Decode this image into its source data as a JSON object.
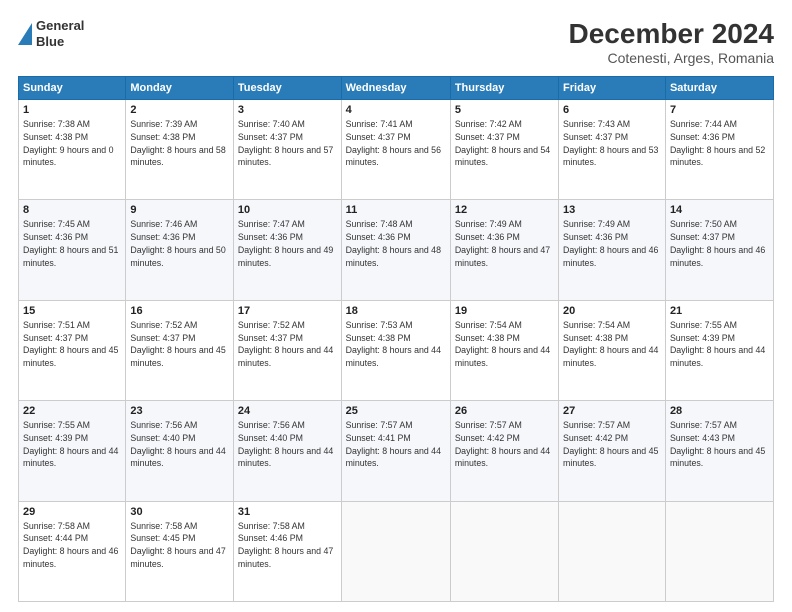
{
  "header": {
    "logo_line1": "General",
    "logo_line2": "Blue",
    "title": "December 2024",
    "subtitle": "Cotenesti, Arges, Romania"
  },
  "weekdays": [
    "Sunday",
    "Monday",
    "Tuesday",
    "Wednesday",
    "Thursday",
    "Friday",
    "Saturday"
  ],
  "weeks": [
    [
      {
        "day": "1",
        "sunrise": "Sunrise: 7:38 AM",
        "sunset": "Sunset: 4:38 PM",
        "daylight": "Daylight: 9 hours and 0 minutes."
      },
      {
        "day": "2",
        "sunrise": "Sunrise: 7:39 AM",
        "sunset": "Sunset: 4:38 PM",
        "daylight": "Daylight: 8 hours and 58 minutes."
      },
      {
        "day": "3",
        "sunrise": "Sunrise: 7:40 AM",
        "sunset": "Sunset: 4:37 PM",
        "daylight": "Daylight: 8 hours and 57 minutes."
      },
      {
        "day": "4",
        "sunrise": "Sunrise: 7:41 AM",
        "sunset": "Sunset: 4:37 PM",
        "daylight": "Daylight: 8 hours and 56 minutes."
      },
      {
        "day": "5",
        "sunrise": "Sunrise: 7:42 AM",
        "sunset": "Sunset: 4:37 PM",
        "daylight": "Daylight: 8 hours and 54 minutes."
      },
      {
        "day": "6",
        "sunrise": "Sunrise: 7:43 AM",
        "sunset": "Sunset: 4:37 PM",
        "daylight": "Daylight: 8 hours and 53 minutes."
      },
      {
        "day": "7",
        "sunrise": "Sunrise: 7:44 AM",
        "sunset": "Sunset: 4:36 PM",
        "daylight": "Daylight: 8 hours and 52 minutes."
      }
    ],
    [
      {
        "day": "8",
        "sunrise": "Sunrise: 7:45 AM",
        "sunset": "Sunset: 4:36 PM",
        "daylight": "Daylight: 8 hours and 51 minutes."
      },
      {
        "day": "9",
        "sunrise": "Sunrise: 7:46 AM",
        "sunset": "Sunset: 4:36 PM",
        "daylight": "Daylight: 8 hours and 50 minutes."
      },
      {
        "day": "10",
        "sunrise": "Sunrise: 7:47 AM",
        "sunset": "Sunset: 4:36 PM",
        "daylight": "Daylight: 8 hours and 49 minutes."
      },
      {
        "day": "11",
        "sunrise": "Sunrise: 7:48 AM",
        "sunset": "Sunset: 4:36 PM",
        "daylight": "Daylight: 8 hours and 48 minutes."
      },
      {
        "day": "12",
        "sunrise": "Sunrise: 7:49 AM",
        "sunset": "Sunset: 4:36 PM",
        "daylight": "Daylight: 8 hours and 47 minutes."
      },
      {
        "day": "13",
        "sunrise": "Sunrise: 7:49 AM",
        "sunset": "Sunset: 4:36 PM",
        "daylight": "Daylight: 8 hours and 46 minutes."
      },
      {
        "day": "14",
        "sunrise": "Sunrise: 7:50 AM",
        "sunset": "Sunset: 4:37 PM",
        "daylight": "Daylight: 8 hours and 46 minutes."
      }
    ],
    [
      {
        "day": "15",
        "sunrise": "Sunrise: 7:51 AM",
        "sunset": "Sunset: 4:37 PM",
        "daylight": "Daylight: 8 hours and 45 minutes."
      },
      {
        "day": "16",
        "sunrise": "Sunrise: 7:52 AM",
        "sunset": "Sunset: 4:37 PM",
        "daylight": "Daylight: 8 hours and 45 minutes."
      },
      {
        "day": "17",
        "sunrise": "Sunrise: 7:52 AM",
        "sunset": "Sunset: 4:37 PM",
        "daylight": "Daylight: 8 hours and 44 minutes."
      },
      {
        "day": "18",
        "sunrise": "Sunrise: 7:53 AM",
        "sunset": "Sunset: 4:38 PM",
        "daylight": "Daylight: 8 hours and 44 minutes."
      },
      {
        "day": "19",
        "sunrise": "Sunrise: 7:54 AM",
        "sunset": "Sunset: 4:38 PM",
        "daylight": "Daylight: 8 hours and 44 minutes."
      },
      {
        "day": "20",
        "sunrise": "Sunrise: 7:54 AM",
        "sunset": "Sunset: 4:38 PM",
        "daylight": "Daylight: 8 hours and 44 minutes."
      },
      {
        "day": "21",
        "sunrise": "Sunrise: 7:55 AM",
        "sunset": "Sunset: 4:39 PM",
        "daylight": "Daylight: 8 hours and 44 minutes."
      }
    ],
    [
      {
        "day": "22",
        "sunrise": "Sunrise: 7:55 AM",
        "sunset": "Sunset: 4:39 PM",
        "daylight": "Daylight: 8 hours and 44 minutes."
      },
      {
        "day": "23",
        "sunrise": "Sunrise: 7:56 AM",
        "sunset": "Sunset: 4:40 PM",
        "daylight": "Daylight: 8 hours and 44 minutes."
      },
      {
        "day": "24",
        "sunrise": "Sunrise: 7:56 AM",
        "sunset": "Sunset: 4:40 PM",
        "daylight": "Daylight: 8 hours and 44 minutes."
      },
      {
        "day": "25",
        "sunrise": "Sunrise: 7:57 AM",
        "sunset": "Sunset: 4:41 PM",
        "daylight": "Daylight: 8 hours and 44 minutes."
      },
      {
        "day": "26",
        "sunrise": "Sunrise: 7:57 AM",
        "sunset": "Sunset: 4:42 PM",
        "daylight": "Daylight: 8 hours and 44 minutes."
      },
      {
        "day": "27",
        "sunrise": "Sunrise: 7:57 AM",
        "sunset": "Sunset: 4:42 PM",
        "daylight": "Daylight: 8 hours and 45 minutes."
      },
      {
        "day": "28",
        "sunrise": "Sunrise: 7:57 AM",
        "sunset": "Sunset: 4:43 PM",
        "daylight": "Daylight: 8 hours and 45 minutes."
      }
    ],
    [
      {
        "day": "29",
        "sunrise": "Sunrise: 7:58 AM",
        "sunset": "Sunset: 4:44 PM",
        "daylight": "Daylight: 8 hours and 46 minutes."
      },
      {
        "day": "30",
        "sunrise": "Sunrise: 7:58 AM",
        "sunset": "Sunset: 4:45 PM",
        "daylight": "Daylight: 8 hours and 47 minutes."
      },
      {
        "day": "31",
        "sunrise": "Sunrise: 7:58 AM",
        "sunset": "Sunset: 4:46 PM",
        "daylight": "Daylight: 8 hours and 47 minutes."
      },
      null,
      null,
      null,
      null
    ]
  ]
}
